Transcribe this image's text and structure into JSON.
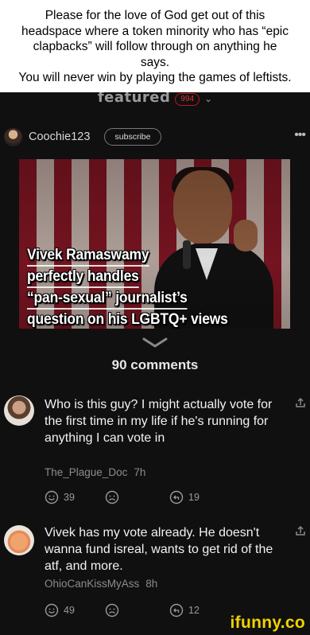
{
  "caption": {
    "lines": [
      "Please for the love of God get out of this",
      "headspace where a token minority who has “epic",
      "clapbacks” will follow through on anything he",
      "says.",
      "You will never win by playing the games of leftists."
    ]
  },
  "app": {
    "featured_title": "featured",
    "featured_count": "994",
    "post": {
      "username": "Coochie123",
      "subscribe_label": "subscribe",
      "more_icon": "more-dots-icon",
      "media_overlay_lines": [
        "Vivek Ramaswamy",
        "perfectly handles",
        "“pan-sexual” journalist’s",
        "question on his LGBTQ+ views"
      ]
    },
    "comments_count_label": "90 comments",
    "comments": [
      {
        "text": "Who is this guy? I might actually vote for the first time in my life if he's running for anything I can vote in",
        "author": "The_Plague_Doc",
        "time": "7h",
        "likes": "39",
        "replies": "19"
      },
      {
        "text": "Vivek has my vote already. He doesn't wanna fund isreal, wants to get rid of the atf, and more.",
        "author": "OhioCanKissMyAss",
        "time": "8h",
        "likes": "49",
        "replies": "12"
      }
    ],
    "watermark": "ifunny.co"
  },
  "colors": {
    "background_dark": "#101010",
    "badge_red": "#e0343a",
    "meta_gray": "#8c8c8c",
    "watermark_yellow": "#f2d200"
  }
}
